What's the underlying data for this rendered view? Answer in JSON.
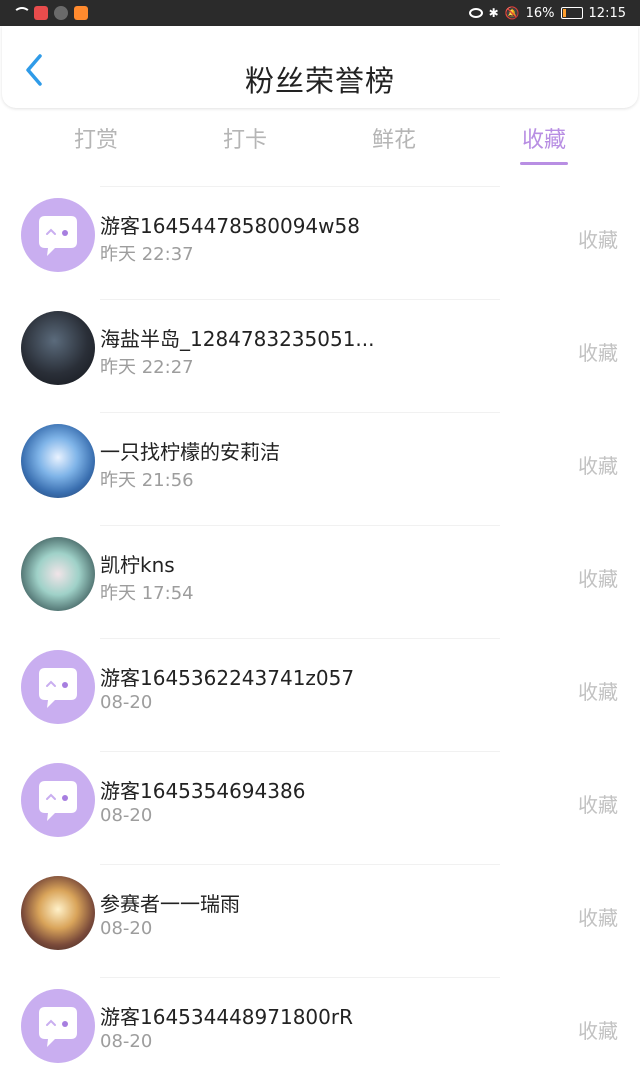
{
  "status_bar": {
    "battery": "16%",
    "time": "12:15",
    "battery_level": 0.16
  },
  "header": {
    "title": "粉丝荣誉榜"
  },
  "tabs": [
    {
      "label": "打赏",
      "active": false
    },
    {
      "label": "打卡",
      "active": false
    },
    {
      "label": "鲜花",
      "active": false
    },
    {
      "label": "收藏",
      "active": true
    }
  ],
  "colors": {
    "accent": "#b88ee3",
    "default_avatar_bg": "#c9aef0"
  },
  "list": {
    "items": [
      {
        "name": "游客16454478580094w58",
        "time": "昨天 22:37",
        "action": "收藏",
        "avatar": "default-avatar-icon"
      },
      {
        "name": "海盐半岛_1284783235051...",
        "time": "昨天 22:27",
        "action": "收藏",
        "avatar": "user-photo"
      },
      {
        "name": "一只找柠檬的安莉洁",
        "time": "昨天 21:56",
        "action": "收藏",
        "avatar": "user-photo"
      },
      {
        "name": "凯柠kns",
        "time": "昨天 17:54",
        "action": "收藏",
        "avatar": "user-photo"
      },
      {
        "name": "游客1645362243741z057",
        "time": "08-20",
        "action": "收藏",
        "avatar": "default-avatar-icon"
      },
      {
        "name": "游客1645354694386",
        "time": "08-20",
        "action": "收藏",
        "avatar": "default-avatar-icon"
      },
      {
        "name": "参赛者一一瑞雨",
        "time": "08-20",
        "action": "收藏",
        "avatar": "user-photo"
      },
      {
        "name": "游客164534448971800rR",
        "time": "08-20",
        "action": "收藏",
        "avatar": "default-avatar-icon"
      }
    ]
  }
}
